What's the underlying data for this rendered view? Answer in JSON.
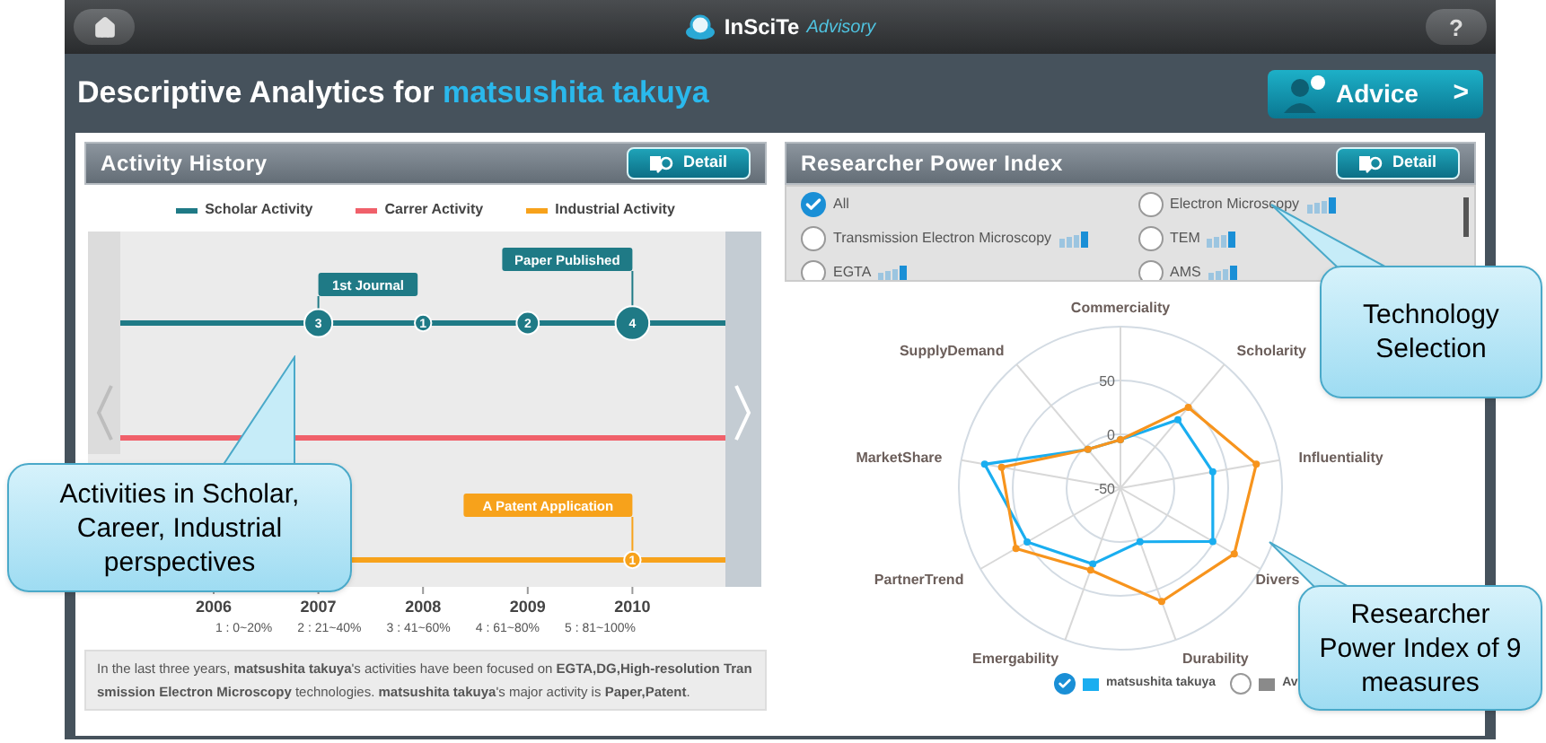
{
  "top_bar": {
    "brand": "InSciTe",
    "brand_sub": "Advisory",
    "help": "?"
  },
  "title": {
    "prefix": "Descriptive Analytics for",
    "name": "matsushita takuya"
  },
  "advice_button": {
    "label": "Advice",
    "arrow": ">"
  },
  "activity_history": {
    "title": "Activity History",
    "detail_button": "Detail",
    "tracks": [
      {
        "kind": "scholar",
        "label": "Scholar Activity",
        "color": "#1f7a86"
      },
      {
        "kind": "career",
        "label": "Carrer Activity",
        "color": "#f0606a"
      },
      {
        "kind": "industrial",
        "label": "Industrial Activity",
        "color": "#f7a21b"
      }
    ],
    "years": [
      {
        "label": "2006"
      },
      {
        "label": "2007",
        "scholar": {
          "count": "3",
          "flag": "1st Journal"
        }
      },
      {
        "label": "2008",
        "scholar": {
          "count": "1"
        }
      },
      {
        "label": "2009",
        "scholar": {
          "count": "2"
        }
      },
      {
        "label": "2010",
        "scholar": {
          "count": "4",
          "flag": "Paper Published"
        },
        "industrial": {
          "count": "1",
          "flag": "A Patent Application"
        }
      }
    ],
    "scale": [
      "1 : 0~20%",
      "2 : 21~40%",
      "3 : 41~60%",
      "4 : 61~80%",
      "5 : 81~100%"
    ],
    "summary": "In the last three years, **matsushita takuya**'s activities have been focused on **EGTA,DG,High-resolution Transmission Electron Microscopy** technologies. **matsushita takuya**'s major activity is **Paper,Patent**."
  },
  "power_index": {
    "title": "Researcher Power Index",
    "detail_button": "Detail",
    "technologies": [
      {
        "label": "All",
        "selected": true,
        "kind": "all"
      },
      {
        "label": "Electron Microscopy",
        "selected": false,
        "kind": "tech"
      },
      {
        "label": "Transmission Electron Microscopy",
        "selected": false,
        "kind": "tech"
      },
      {
        "label": "TEM",
        "selected": false,
        "kind": "tech"
      },
      {
        "label": "EGTA",
        "selected": false,
        "kind": "tech"
      },
      {
        "label": "AMS",
        "selected": false,
        "kind": "tech"
      }
    ],
    "chart_data": {
      "type": "radar",
      "categories": [
        "Commerciality",
        "Scholarity",
        "Influentiality",
        "Divers",
        "Durability",
        "Emergability",
        "PartnerTrend",
        "MarketShare",
        "SupplyDemand"
      ],
      "ylim": [
        -50,
        100
      ],
      "yticks": [
        -50,
        0,
        50
      ],
      "series": [
        {
          "name": "matsushita takuya",
          "color": "#1aaef0",
          "values": [
            -5,
            33,
            37,
            49,
            3,
            25,
            50,
            78,
            -3
          ]
        },
        {
          "name": "Av",
          "color": "#f7941d",
          "values": [
            -5,
            48,
            78,
            72,
            62,
            31,
            62,
            62,
            -3
          ]
        }
      ]
    },
    "legend": [
      {
        "selected": true
      },
      {
        "selected": false
      }
    ]
  },
  "callouts": [
    {
      "text": "Activities in Scholar, Career, Industrial perspectives"
    },
    {
      "text": "Technology Selection"
    },
    {
      "text": "Researcher Power Index of 9 measures"
    }
  ]
}
